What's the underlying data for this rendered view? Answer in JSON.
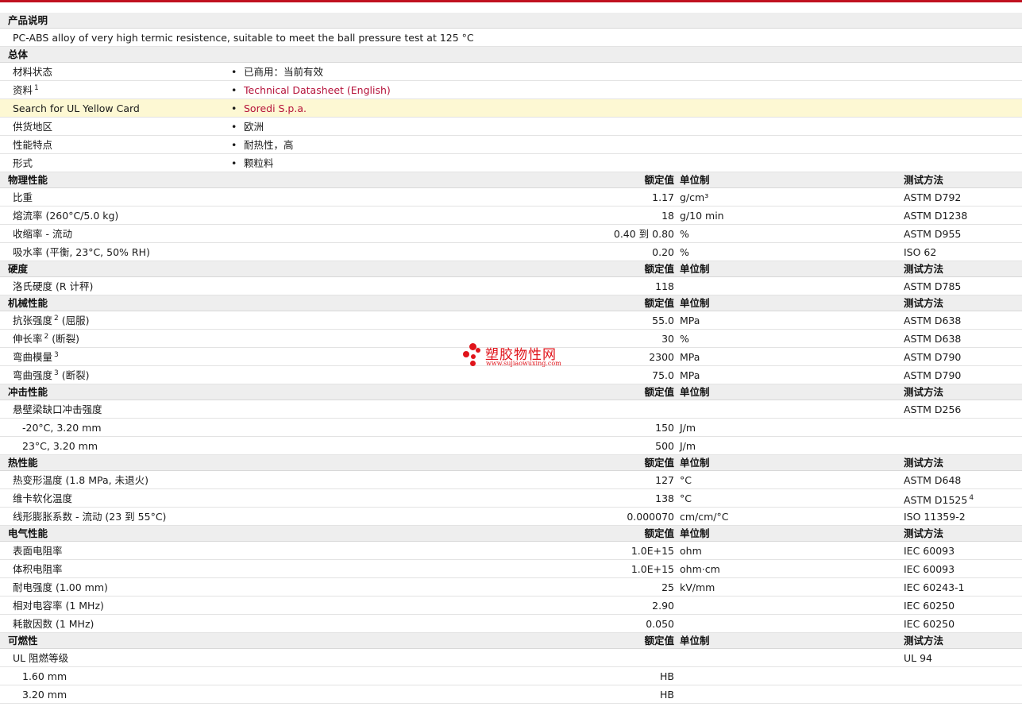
{
  "description": {
    "title": "产品说明",
    "text": "PC-ABS alloy of very high termic resistence, suitable to meet the ball pressure test at 125 °C"
  },
  "general": {
    "title": "总体",
    "rows": [
      {
        "label": "材料状态",
        "value": "已商用：当前有效"
      },
      {
        "label": "资料",
        "sup": "1",
        "value": "Technical Datasheet (English)"
      },
      {
        "label": "Search for UL Yellow Card",
        "value": "Soredi S.p.a."
      },
      {
        "label": "供货地区",
        "value": "欧洲"
      },
      {
        "label": "性能特点",
        "value": "耐热性，高"
      },
      {
        "label": "形式",
        "value": "颗粒料"
      }
    ]
  },
  "col_headers": {
    "value": "额定值",
    "unit": "单位制",
    "method": "测试方法"
  },
  "physical": {
    "title": "物理性能",
    "rows": [
      {
        "label": "比重",
        "value": "1.17",
        "unit": "g/cm³",
        "method": "ASTM D792"
      },
      {
        "label": "熔流率  (260°C/5.0 kg)",
        "value": "18",
        "unit": "g/10 min",
        "method": "ASTM D1238"
      },
      {
        "label": "收缩率  - 流动",
        "value": "0.40 到  0.80",
        "unit": "%",
        "method": "ASTM D955"
      },
      {
        "label": "吸水率  (平衡, 23°C, 50% RH)",
        "value": "0.20",
        "unit": "%",
        "method": "ISO 62"
      }
    ]
  },
  "hardness": {
    "title": "硬度",
    "rows": [
      {
        "label": "洛氏硬度  (R 计秤)",
        "value": "118",
        "unit": "",
        "method": "ASTM D785"
      }
    ]
  },
  "mechanical": {
    "title": "机械性能",
    "rows": [
      {
        "label": "抗张强度",
        "sup": "2",
        "suffix": "(屈服)",
        "value": "55.0",
        "unit": "MPa",
        "method": "ASTM D638"
      },
      {
        "label": "伸长率",
        "sup": "2",
        "suffix": "(断裂)",
        "value": "30",
        "unit": "%",
        "method": "ASTM D638"
      },
      {
        "label": "弯曲模量",
        "sup": "3",
        "suffix": "",
        "value": "2300",
        "unit": "MPa",
        "method": "ASTM D790"
      },
      {
        "label": "弯曲强度",
        "sup": "3",
        "suffix": "(断裂)",
        "value": "75.0",
        "unit": "MPa",
        "method": "ASTM D790"
      }
    ]
  },
  "impact": {
    "title": "冲击性能",
    "rows": [
      {
        "label": "悬壁梁缺口冲击强度",
        "value": "",
        "unit": "",
        "method": "ASTM D256"
      },
      {
        "label": "-20°C, 3.20 mm",
        "value": "150",
        "unit": "J/m",
        "method": ""
      },
      {
        "label": "23°C, 3.20 mm",
        "value": "500",
        "unit": "J/m",
        "method": ""
      }
    ]
  },
  "thermal": {
    "title": "热性能",
    "rows": [
      {
        "label": "热变形温度  (1.8 MPa, 未退火)",
        "value": "127",
        "unit": "°C",
        "method": "ASTM D648"
      },
      {
        "label": "维卡软化温度",
        "value": "138",
        "unit": "°C",
        "method": "ASTM D1525",
        "method_sup": "4"
      },
      {
        "label": "线形膨胀系数  - 流动  (23 到  55°C)",
        "value": "0.000070",
        "unit": "cm/cm/°C",
        "method": "ISO 11359-2"
      }
    ]
  },
  "electrical": {
    "title": "电气性能",
    "rows": [
      {
        "label": "表面电阻率",
        "value": "1.0E+15",
        "unit": "ohm",
        "method": "IEC 60093"
      },
      {
        "label": "体积电阻率",
        "value": "1.0E+15",
        "unit": "ohm·cm",
        "method": "IEC 60093"
      },
      {
        "label": "耐电强度  (1.00 mm)",
        "value": "25",
        "unit": "kV/mm",
        "method": "IEC 60243-1"
      },
      {
        "label": "相对电容率  (1 MHz)",
        "value": "2.90",
        "unit": "",
        "method": "IEC 60250"
      },
      {
        "label": "耗散因数  (1 MHz)",
        "value": "0.050",
        "unit": "",
        "method": "IEC 60250"
      }
    ]
  },
  "flammability": {
    "title": "可燃性",
    "rows": [
      {
        "label": "UL 阻燃等级",
        "value": "",
        "unit": "",
        "method": "UL 94"
      },
      {
        "label": "1.60 mm",
        "value": "HB",
        "unit": "",
        "method": ""
      },
      {
        "label": "3.20 mm",
        "value": "HB",
        "unit": "",
        "method": ""
      }
    ]
  },
  "watermark": {
    "text": "塑胶物性网",
    "url": "www.sujiaowuxing.com",
    "color": "#e0141b"
  },
  "colors": {
    "accent": "#c0111f",
    "link": "#b5123a",
    "highlight": "#fdf8d3",
    "section_bg": "#eeeeee"
  }
}
